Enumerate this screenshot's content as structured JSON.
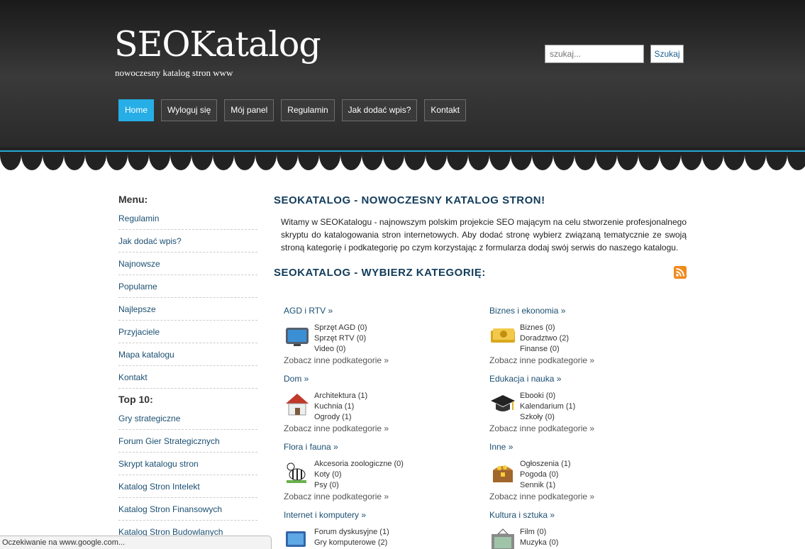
{
  "header": {
    "title": "SEOKatalog",
    "subtitle": "nowoczesny katalog stron www",
    "search_placeholder": "szukaj...",
    "search_button": "Szukaj"
  },
  "nav": [
    {
      "label": "Home",
      "active": true
    },
    {
      "label": "Wyloguj się"
    },
    {
      "label": "Mój panel"
    },
    {
      "label": "Regulamin"
    },
    {
      "label": "Jak dodać wpis?"
    },
    {
      "label": "Kontakt"
    }
  ],
  "sidebar": {
    "menu_heading": "Menu:",
    "menu": [
      "Regulamin",
      "Jak dodać wpis?",
      "Najnowsze",
      "Popularne",
      "Najlepsze",
      "Przyjaciele",
      "Mapa katalogu",
      "Kontakt"
    ],
    "top_heading": "Top 10:",
    "top": [
      "Gry strategiczne",
      "Forum Gier Strategicznych",
      "Skrypt katalogu stron",
      "Katalog Stron Intelekt",
      "Katalog Stron Finansowych",
      "Katalog Stron Budowlanych"
    ]
  },
  "main": {
    "title": "SEOKATALOG - NOWOCZESNY KATALOG STRON!",
    "intro": "Witamy w SEOKatalogu - najnowszym polskim projekcie SEO mającym na celu stworzenie profesjonalnego skryptu do katalogowania stron internetowych. Aby dodać stronę wybierz związaną tematycznie ze swoją stroną kategorię i podkategorię po czym korzystając z formularza dodaj swój serwis do naszego katalogu.",
    "cat_title": "SEOKATALOG - WYBIERZ KATEGORIĘ:",
    "more_label": "Zobacz inne podkategorie »"
  },
  "categories": [
    {
      "name": "AGD i RTV »",
      "icon": "tv-icon",
      "subs": [
        "Sprzęt AGD (0)",
        "Sprzęt RTV (0)",
        "Video (0)"
      ]
    },
    {
      "name": "Biznes i ekonomia »",
      "icon": "money-icon",
      "subs": [
        "Biznes (0)",
        "Doradztwo (2)",
        "Finanse (0)"
      ]
    },
    {
      "name": "Dom »",
      "icon": "house-icon",
      "subs": [
        "Architektura (1)",
        "Kuchnia (1)",
        "Ogrody (1)"
      ]
    },
    {
      "name": "Edukacja i nauka »",
      "icon": "graduation-cap-icon",
      "subs": [
        "Ebooki (0)",
        "Kalendarium (1)",
        "Szkoły (0)"
      ]
    },
    {
      "name": "Flora i fauna »",
      "icon": "zebra-icon",
      "subs": [
        "Akcesoria zoologiczne (0)",
        "Koty (0)",
        "Psy (0)"
      ]
    },
    {
      "name": "Inne »",
      "icon": "treasure-chest-icon",
      "subs": [
        "Ogłoszenia (1)",
        "Pogoda (0)",
        "Sennik (1)"
      ]
    },
    {
      "name": "Internet i komputery »",
      "icon": "computer-icon",
      "subs": [
        "Forum dyskusyjne (1)",
        "Gry komputerowe (2)"
      ]
    },
    {
      "name": "Kultura i sztuka »",
      "icon": "picture-frame-icon",
      "subs": [
        "Film (0)",
        "Muzyka (0)"
      ]
    }
  ],
  "status_text": "Oczekiwanie na www.google.com...",
  "colors": {
    "accent": "#27aee6",
    "link": "#1b4f72",
    "title": "#123c5a",
    "rss": "#f28a1e"
  }
}
